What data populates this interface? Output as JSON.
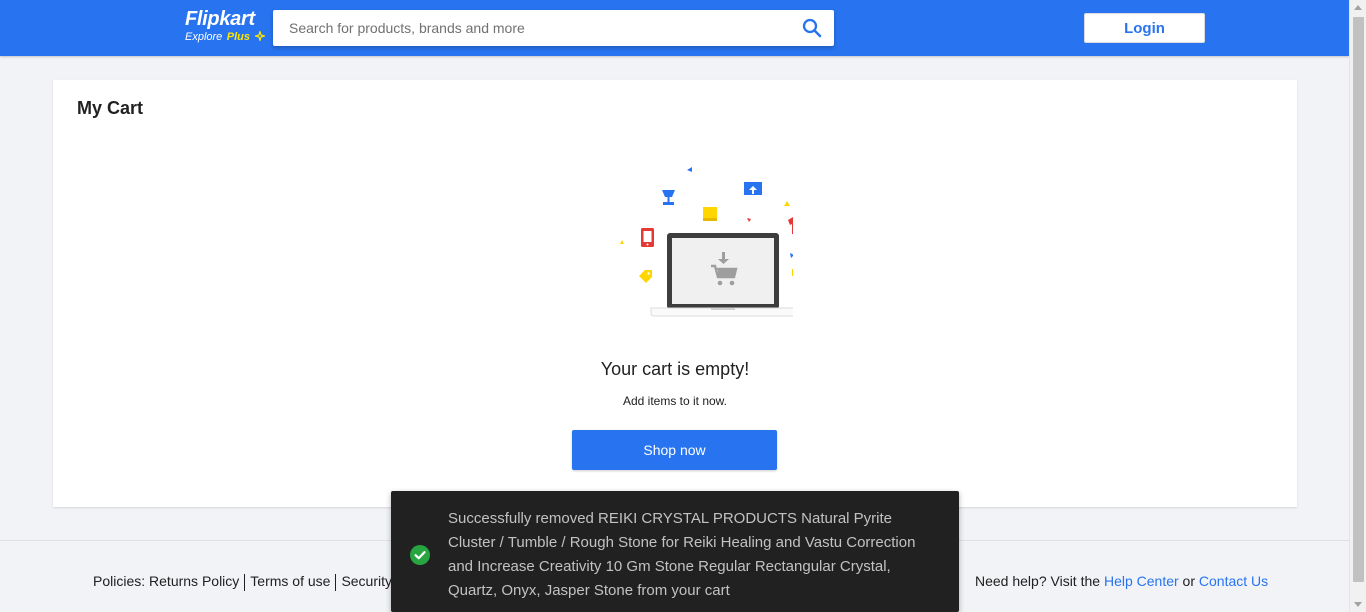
{
  "header": {
    "logo_text": "Flipkart",
    "logo_sub_explore": "Explore",
    "logo_sub_plus": "Plus",
    "search_placeholder": "Search for products, brands and more",
    "search_icon": "search-icon",
    "login_label": "Login",
    "brand_color": "#2874f0",
    "plus_color": "#ffe500"
  },
  "cart": {
    "title": "My Cart",
    "illustration_icon": "empty-cart-illustration",
    "empty_title": "Your cart is empty!",
    "empty_subtitle": "Add items to it now.",
    "shop_now_label": "Shop now"
  },
  "footer": {
    "policies_label": "Policies:",
    "policy_links": [
      "Returns Policy",
      "Terms of use",
      "Security"
    ],
    "help_prefix": "Need help? Visit the",
    "help_center_label": "Help Center",
    "help_or": "or",
    "contact_us_label": "Contact Us"
  },
  "toast": {
    "icon": "success-check-icon",
    "message": "Successfully removed REIKI CRYSTAL PRODUCTS Natural Pyrite Cluster / Tumble / Rough Stone for Reiki Healing and Vastu Correction and Increase Creativity 10 Gm Stone Regular Rectangular Crystal, Quartz, Onyx, Jasper Stone from your cart",
    "success_color": "#26a541"
  }
}
